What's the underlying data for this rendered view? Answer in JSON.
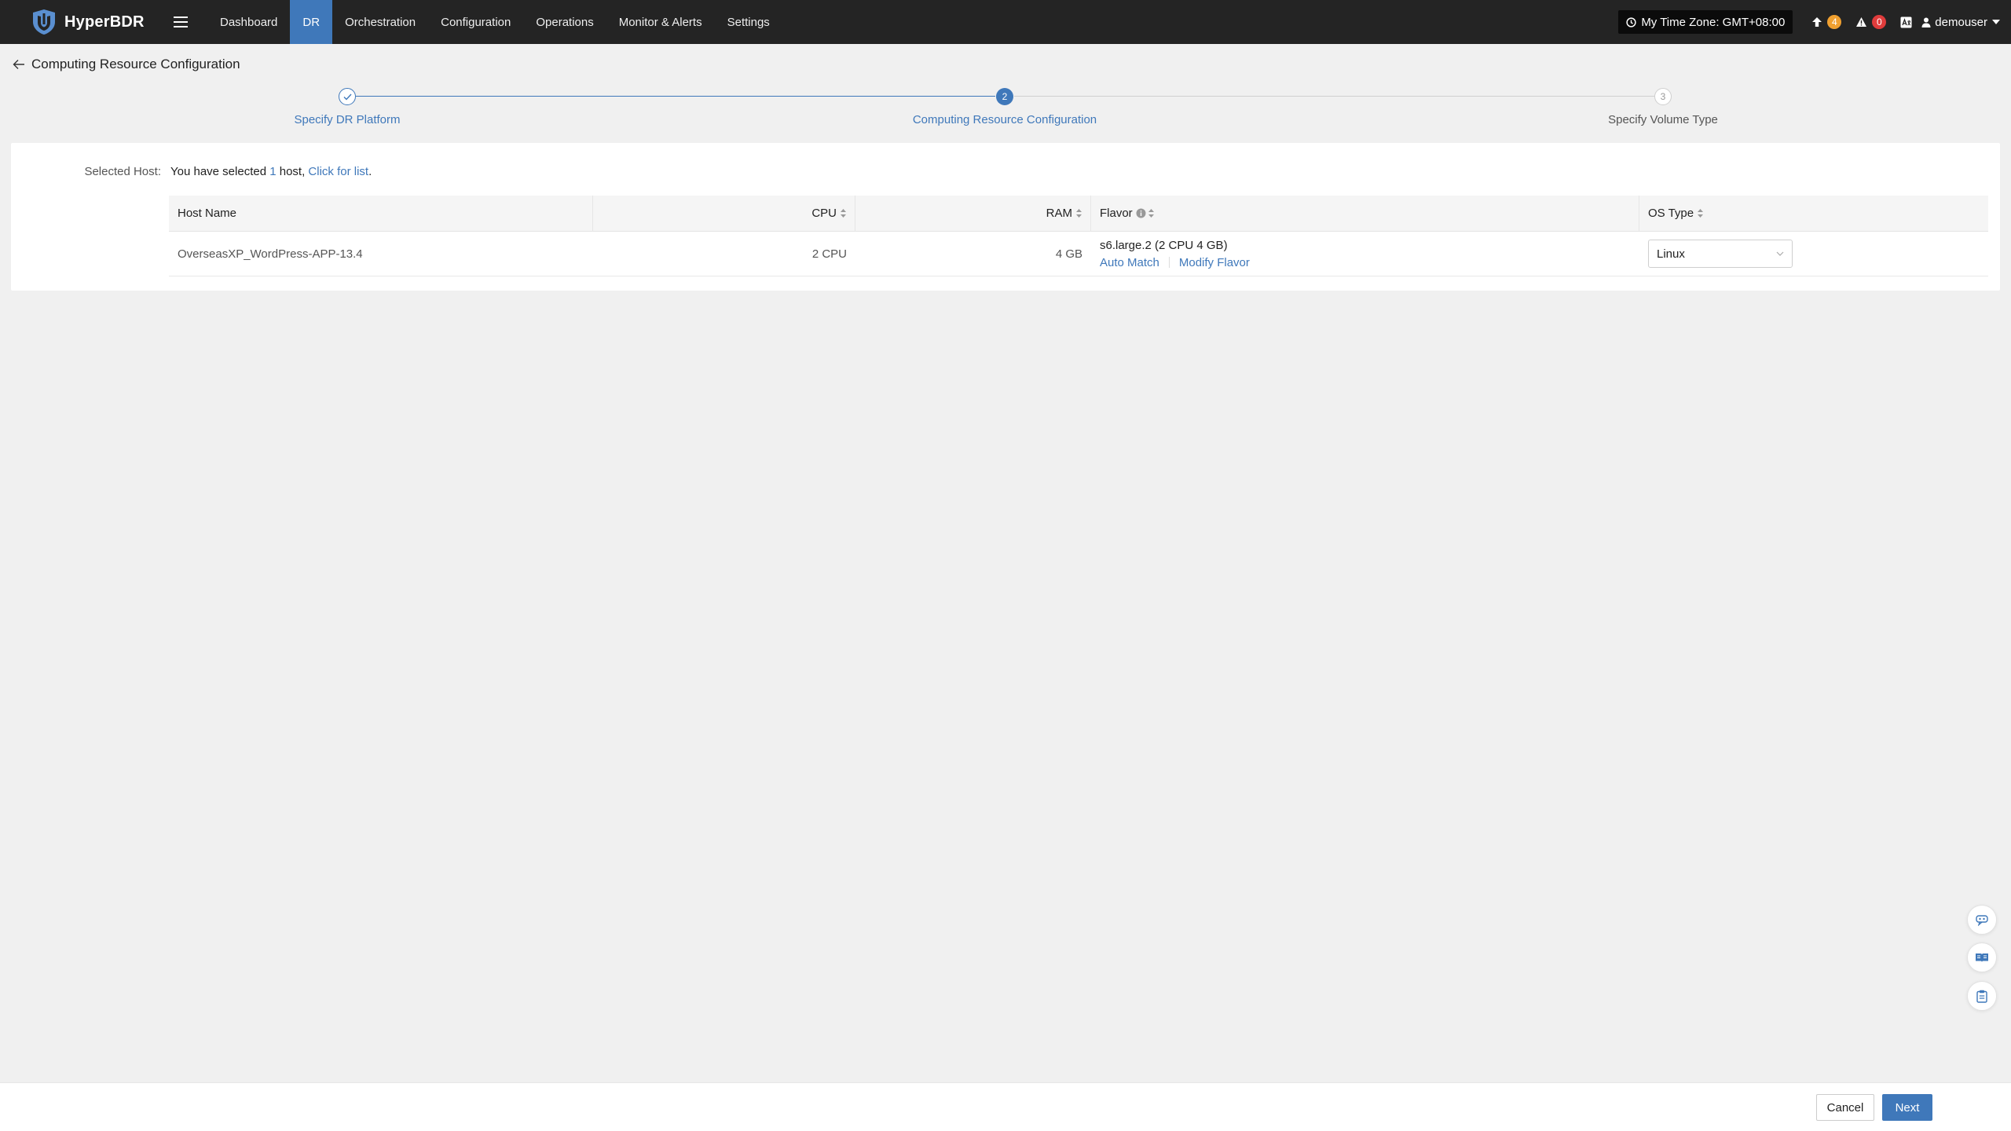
{
  "app": {
    "name": "HyperBDR"
  },
  "nav": {
    "items": [
      {
        "label": "Dashboard",
        "active": false
      },
      {
        "label": "DR",
        "active": true
      },
      {
        "label": "Orchestration",
        "active": false
      },
      {
        "label": "Configuration",
        "active": false
      },
      {
        "label": "Operations",
        "active": false
      },
      {
        "label": "Monitor & Alerts",
        "active": false
      },
      {
        "label": "Settings",
        "active": false
      }
    ]
  },
  "topbar": {
    "timezone": "My Time Zone: GMT+08:00",
    "upgrade_count": "4",
    "alert_count": "0",
    "username": "demouser"
  },
  "page": {
    "title": "Computing Resource Configuration"
  },
  "steps": [
    {
      "number": "1",
      "label": "Specify DR Platform",
      "state": "done"
    },
    {
      "number": "2",
      "label": "Computing Resource Configuration",
      "state": "active"
    },
    {
      "number": "3",
      "label": "Specify Volume Type",
      "state": "pending"
    }
  ],
  "selection": {
    "label": "Selected Host:",
    "text_prefix": "You have selected ",
    "count": "1",
    "text_suffix": " host, ",
    "link": "Click for list",
    "end": "."
  },
  "table": {
    "columns": {
      "host": "Host Name",
      "cpu": "CPU",
      "ram": "RAM",
      "flavor": "Flavor",
      "os": "OS Type"
    },
    "rows": [
      {
        "host": "OverseasXP_WordPress-APP-13.4",
        "cpu": "2 CPU",
        "ram": "4 GB",
        "flavor": "s6.large.2 (2 CPU 4 GB)",
        "auto_match": "Auto Match",
        "modify_flavor": "Modify Flavor",
        "os_type": "Linux"
      }
    ]
  },
  "footer": {
    "cancel": "Cancel",
    "next": "Next"
  },
  "colors": {
    "accent": "#3f78ba",
    "topbar": "#242424",
    "badge_orange": "#f0a030",
    "badge_red": "#e03c3c"
  }
}
